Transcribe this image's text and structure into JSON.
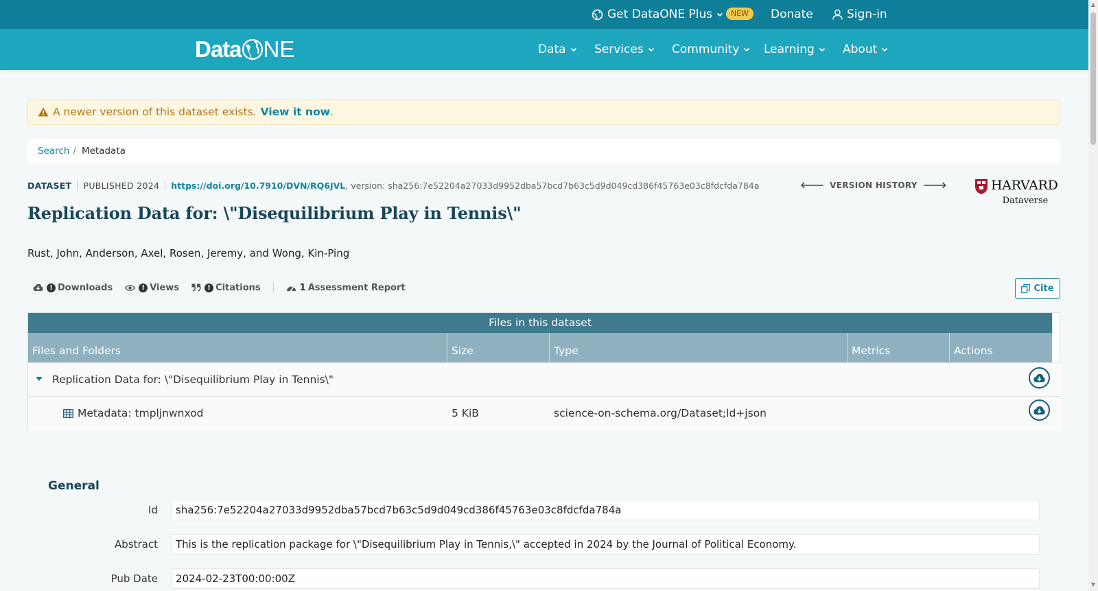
{
  "topbar": {
    "get_plus": "Get DataONE Plus",
    "new_badge": "NEW",
    "donate": "Donate",
    "sign_in": "Sign-in"
  },
  "nav": {
    "logo_data": "Data",
    "logo_one": "NE",
    "items": [
      {
        "label": "Data"
      },
      {
        "label": "Services"
      },
      {
        "label": "Community"
      },
      {
        "label": "Learning"
      },
      {
        "label": "About"
      }
    ]
  },
  "alert": {
    "message": "A newer version of this dataset exists.",
    "link_text": "View it now",
    "trailing": "."
  },
  "breadcrumb": {
    "search": "Search",
    "separator": "/",
    "current": "Metadata"
  },
  "dataset": {
    "type_label": "DATASET",
    "published": "PUBLISHED 2024",
    "doi": "https://doi.org/10.7910/DVN/RQ6JVL",
    "version": ", version: sha256:7e52204a27033d9952dba57bcd7b63c5d9d049cd386f45763e03c8fdcfda784a",
    "version_history": "VERSION HISTORY",
    "title": "Replication Data for: \\\"Disequilibrium Play in Tennis\\\"",
    "authors": "Rust, John, Anderson, Axel, Rosen, Jeremy, and Wong, Kin-Ping",
    "repository_name": "HARVARD",
    "repository_sub": "Dataverse"
  },
  "stats": {
    "downloads_label": "Downloads",
    "views_label": "Views",
    "citations_label": "Citations",
    "assessment_count": "1",
    "assessment_label": "Assessment Report",
    "cite_label": "Cite"
  },
  "files": {
    "title": "Files in this dataset",
    "columns": [
      "Files and Folders",
      "Size",
      "Type",
      "Metrics",
      "Actions"
    ],
    "folder_name": "Replication Data for: \\\"Disequilibrium Play in Tennis\\\"",
    "rows": [
      {
        "name": "Metadata: tmpljnwnxod",
        "size": "5 KiB",
        "type": "science-on-schema.org/Dataset;ld+json"
      }
    ]
  },
  "general": {
    "heading": "General",
    "fields": [
      {
        "label": "Id",
        "value": "sha256:7e52204a27033d9952dba57bcd7b63c5d9d049cd386f45763e03c8fdcfda784a"
      },
      {
        "label": "Abstract",
        "value": "This is the replication package for \\\"Disequilibrium Play in Tennis,\\\" accepted in 2024 by the Journal of Political Economy."
      },
      {
        "label": "Pub Date",
        "value": "2024-02-23T00:00:00Z"
      }
    ]
  },
  "colors": {
    "topbar": "#0f7e98",
    "navbar": "#1fa6bf",
    "accent": "#13849f",
    "title": "#19465a",
    "alert_bg": "#fdf6e1"
  }
}
